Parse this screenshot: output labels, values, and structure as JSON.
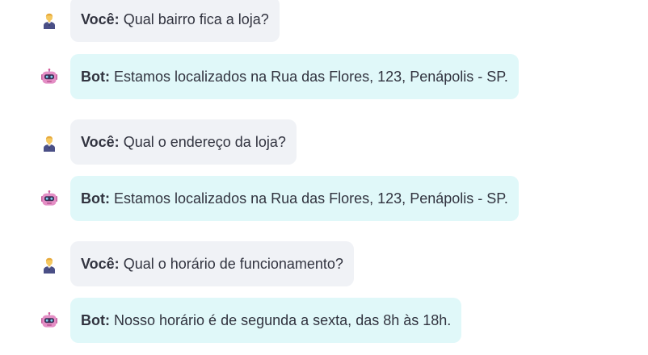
{
  "chat": {
    "messages": [
      {
        "role": "user",
        "avatar_icon": "user-avatar-icon",
        "speaker": "Você:",
        "text": "Qual bairro fica a loja?"
      },
      {
        "role": "bot",
        "avatar_icon": "robot-avatar-icon",
        "speaker": "Bot:",
        "text": "Estamos localizados na Rua das Flores, 123, Penápolis - SP."
      },
      {
        "role": "user",
        "avatar_icon": "user-avatar-icon",
        "speaker": "Você:",
        "text": "Qual o endereço da loja?"
      },
      {
        "role": "bot",
        "avatar_icon": "robot-avatar-icon",
        "speaker": "Bot:",
        "text": "Estamos localizados na Rua das Flores, 123, Penápolis - SP."
      },
      {
        "role": "user",
        "avatar_icon": "user-avatar-icon",
        "speaker": "Você:",
        "text": "Qual o horário de funcionamento?"
      },
      {
        "role": "bot",
        "avatar_icon": "robot-avatar-icon",
        "speaker": "Bot:",
        "text": "Nosso horário é de segunda a sexta, das 8h às 18h."
      }
    ]
  },
  "colors": {
    "user_bubble": "#f0f2f6",
    "bot_bubble": "#e0f8f9",
    "text": "#31333f"
  }
}
